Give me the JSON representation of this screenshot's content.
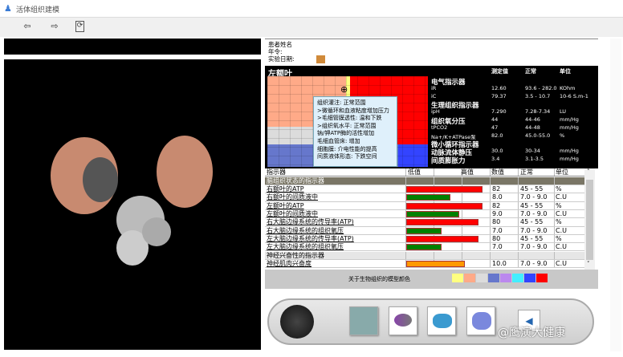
{
  "window": {
    "title": "活体组织建模"
  },
  "toolbar": {
    "back": "⇦",
    "forward": "⇨",
    "refresh": "⟳"
  },
  "patient": {
    "name_label": "患者姓名",
    "age_label": "年令:",
    "date_label": "实验日期:"
  },
  "region": {
    "title": "左额叶"
  },
  "tooltip": [
    "组织灌注: 正常范围",
    ">微循环和血液粘度增加压力",
    ">毛细管膜透性: 温和下跌",
    ">组织氧水平: 正常范围",
    "钠/钾ATP酶的活性增加",
    "毛细血管床: 增加",
    "细胞膜: 介电性能的提高",
    "间质液体形态: 下跌空间"
  ],
  "indicators": {
    "headers": [
      "测定值",
      "正常",
      "单位"
    ],
    "rows": [
      {
        "label": "电气指示器",
        "section": true
      },
      {
        "label": "iR",
        "value": "12.60",
        "normal": "93.6 - 282.0",
        "unit": "KOhm"
      },
      {
        "label": "iC",
        "value": "79.37",
        "normal": "3.5 - 10.7",
        "unit": "10-6 S.m-1"
      },
      {
        "label": "生理组织指示器",
        "section": true
      },
      {
        "label": "ipH",
        "value": "7.290",
        "normal": "7.28-7.34",
        "unit": "LU"
      },
      {
        "label": "组织氧分压",
        "value": "44",
        "normal": "44-46",
        "unit": "mm/Hg",
        "big": true
      },
      {
        "label": "tPCO2",
        "value": "47",
        "normal": "44-48",
        "unit": "mm/Hg"
      },
      {
        "label": "Na+/K+ATPase泵",
        "value": "82.0",
        "normal": "45.0-55.0",
        "unit": "%"
      },
      {
        "label": "微小循环指示器",
        "section": true
      },
      {
        "label": "动脉流体静压",
        "value": "30.0",
        "normal": "30-34",
        "unit": "mm/Hg",
        "big": true
      },
      {
        "label": "间质膨胀力",
        "value": "3.4",
        "normal": "3.1-3.5",
        "unit": "mm/Hg",
        "big": true
      }
    ]
  },
  "table": {
    "headers": [
      "指示器",
      "低值",
      "高值",
      "数值",
      "正常",
      "单位"
    ],
    "rows": [
      {
        "name": "脑组织状态的指示器",
        "type": "section"
      },
      {
        "name": "右额叶的ATP",
        "value": "82",
        "normal": "45 - 55",
        "unit": "%",
        "bar_fill": 0.95,
        "color": "#ff0000"
      },
      {
        "name": "右额叶的间质液中",
        "value": "8.0",
        "normal": "7.0 - 9.0",
        "unit": "C.U",
        "bar_fill": 0.55,
        "color": "#008000"
      },
      {
        "name": "左额叶的ATP",
        "value": "82",
        "normal": "45 - 55",
        "unit": "%",
        "bar_fill": 0.95,
        "color": "#ff0000"
      },
      {
        "name": "左额叶的间质液中",
        "value": "9.0",
        "normal": "7.0 - 9.0",
        "unit": "C.U",
        "bar_fill": 0.66,
        "color": "#008000"
      },
      {
        "name": "右大脑边缘系统的传导率(ATP)",
        "value": "80",
        "normal": "45 - 55",
        "unit": "%",
        "bar_fill": 0.9,
        "color": "#ff0000"
      },
      {
        "name": "右大脑边缘系统的组织氧压",
        "value": "7.0",
        "normal": "7.0 - 9.0",
        "unit": "C.U",
        "bar_fill": 0.44,
        "color": "#008000"
      },
      {
        "name": "左大脑边缘系统的传导率(ATP)",
        "value": "80",
        "normal": "45 - 55",
        "unit": "%",
        "bar_fill": 0.9,
        "color": "#ff0000"
      },
      {
        "name": "左大脑边缘系统的组织氧压",
        "value": "7.0",
        "normal": "7.0 - 9.0",
        "unit": "C.U",
        "bar_fill": 0.44,
        "color": "#008000"
      },
      {
        "name": "神经兴奋性的指示器",
        "type": "section2"
      },
      {
        "name": "神经肌肉兴奋度",
        "value": "10.0",
        "normal": "7.0 - 9.0",
        "unit": "C.U",
        "bar_fill": 0.73,
        "color": "#ff9900"
      }
    ]
  },
  "legend": {
    "label": "关于生物组织的模型颜色",
    "colors": [
      "#ffff80",
      "#ffaa88",
      "#dcdcdc",
      "#6677cc",
      "#bb88ee",
      "#44eeff",
      "#3344ff",
      "#ff0000"
    ]
  },
  "watermark": "@鹰演大健康"
}
